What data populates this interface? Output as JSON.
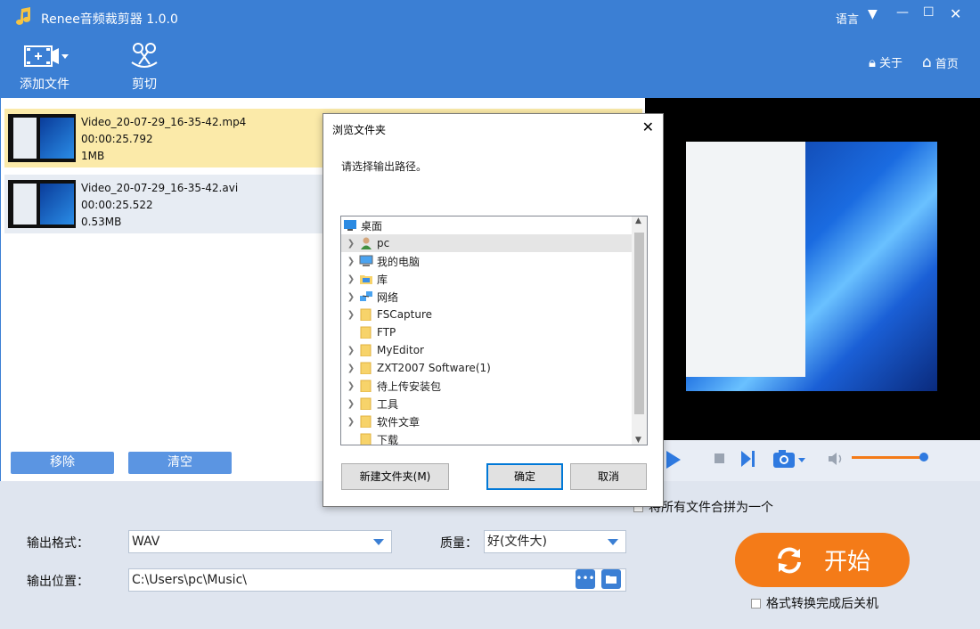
{
  "app": {
    "title": "Renee音频裁剪器 1.0.0",
    "language": "语言",
    "about": "关于",
    "home": "首页"
  },
  "toolbar": {
    "add_file": "添加文件",
    "cut": "剪切"
  },
  "files": [
    {
      "name": "Video_20-07-29_16-35-42.mp4",
      "duration": "00:00:25.792",
      "size": "1MB"
    },
    {
      "name": "Video_20-07-29_16-35-42.avi",
      "duration": "00:00:25.522",
      "size": "0.53MB"
    }
  ],
  "list_buttons": {
    "remove": "移除",
    "clear": "清空"
  },
  "output": {
    "format_label": "输出格式：",
    "format_value": "WAV",
    "quality_label": "质量：",
    "quality_value": "好(文件大)",
    "location_label": "输出位置：",
    "location_value": "C:\\Users\\pc\\Music\\",
    "merge_label": "将所有文件合拼为一个",
    "shutdown_label": "格式转换完成后关机",
    "start_label": "开始"
  },
  "dialog": {
    "title": "浏览文件夹",
    "close": "✕",
    "prompt": "请选择输出路径。",
    "tree": [
      {
        "label": "桌面",
        "icon": "desktop-icon",
        "expandable": false
      },
      {
        "label": "pc",
        "icon": "user-icon",
        "expandable": true
      },
      {
        "label": "我的电脑",
        "icon": "computer-icon",
        "expandable": true
      },
      {
        "label": "库",
        "icon": "library-icon",
        "expandable": true
      },
      {
        "label": "网络",
        "icon": "network-icon",
        "expandable": true
      },
      {
        "label": "FSCapture",
        "icon": "folder-icon",
        "expandable": true
      },
      {
        "label": "FTP",
        "icon": "folder-icon",
        "expandable": false
      },
      {
        "label": "MyEditor",
        "icon": "folder-icon",
        "expandable": true
      },
      {
        "label": "ZXT2007 Software(1)",
        "icon": "folder-icon",
        "expandable": true
      },
      {
        "label": "待上传安装包",
        "icon": "folder-icon",
        "expandable": true
      },
      {
        "label": "工具",
        "icon": "folder-icon",
        "expandable": true
      },
      {
        "label": "软件文章",
        "icon": "folder-icon",
        "expandable": true
      },
      {
        "label": "下载",
        "icon": "folder-icon",
        "expandable": false
      }
    ],
    "new_folder": "新建文件夹(M)",
    "ok": "确定",
    "cancel": "取消"
  },
  "colors": {
    "accent": "#3b7fd4",
    "start": "#f47b18",
    "selected_row": "#fbeaa9"
  }
}
